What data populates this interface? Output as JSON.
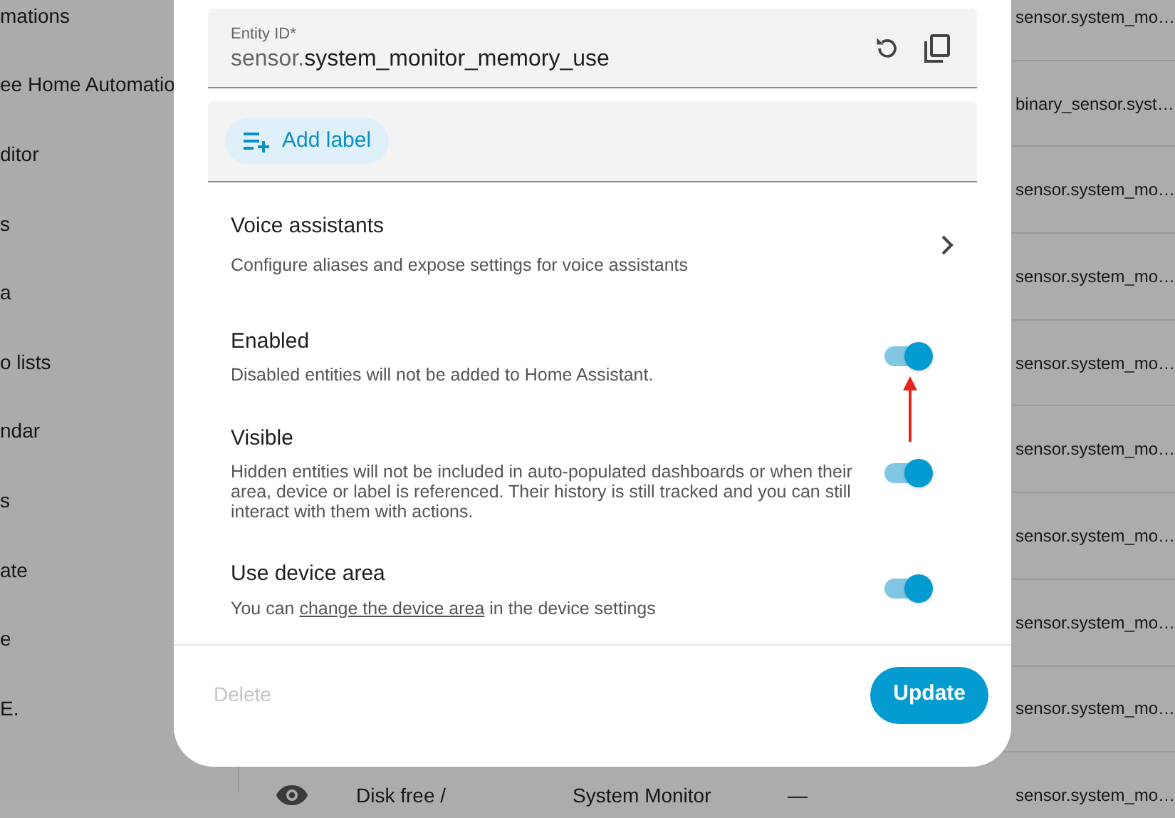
{
  "background": {
    "sidebar_items": [
      {
        "label": "mations"
      },
      {
        "label": "ee Home Automatio"
      },
      {
        "label": "ditor"
      },
      {
        "label": "s"
      },
      {
        "label": "a"
      },
      {
        "label": "o lists"
      },
      {
        "label": "ndar"
      },
      {
        "label": "s"
      },
      {
        "label": "ate"
      },
      {
        "label": "e"
      },
      {
        "label": "E."
      }
    ],
    "table_rows": [
      {
        "entity_id": "sensor.system_mo…"
      },
      {
        "entity_id": "binary_sensor.syst…"
      },
      {
        "entity_id": "sensor.system_mo…"
      },
      {
        "entity_id": "sensor.system_mo…"
      },
      {
        "entity_id": "sensor.system_mo…"
      },
      {
        "entity_id": "sensor.system_mo…"
      },
      {
        "entity_id": "sensor.system_mo…"
      },
      {
        "entity_id": "sensor.system_mo…"
      },
      {
        "entity_id": "sensor.system_mo…"
      },
      {
        "name": "Disk free /",
        "integration": "System Monitor",
        "area": "—",
        "entity_id": "sensor.system_mo…"
      }
    ]
  },
  "dialog": {
    "entity_id_field": {
      "label": "Entity ID*",
      "prefix": "sensor.",
      "value": "system_monitor_memory_use"
    },
    "add_label": "Add label",
    "voice_assistants": {
      "title": "Voice assistants",
      "subtitle": "Configure aliases and expose settings for voice assistants"
    },
    "settings": [
      {
        "title": "Enabled",
        "description": "Disabled entities will not be added to Home Assistant.",
        "on": true,
        "annotated": true
      },
      {
        "title": "Visible",
        "description": "Hidden entities will not be included in auto-populated dashboards or when their area, device or label is referenced. Their history is still tracked and you can still interact with them with actions.",
        "on": true,
        "annotated": false
      },
      {
        "title": "Use device area",
        "description_before": "You can ",
        "link": "change the device area",
        "description_after": " in the device settings",
        "on": true,
        "annotated": false
      }
    ],
    "buttons": {
      "delete": {
        "label": "Delete",
        "disabled": true
      },
      "update": {
        "label": "Update"
      }
    }
  }
}
